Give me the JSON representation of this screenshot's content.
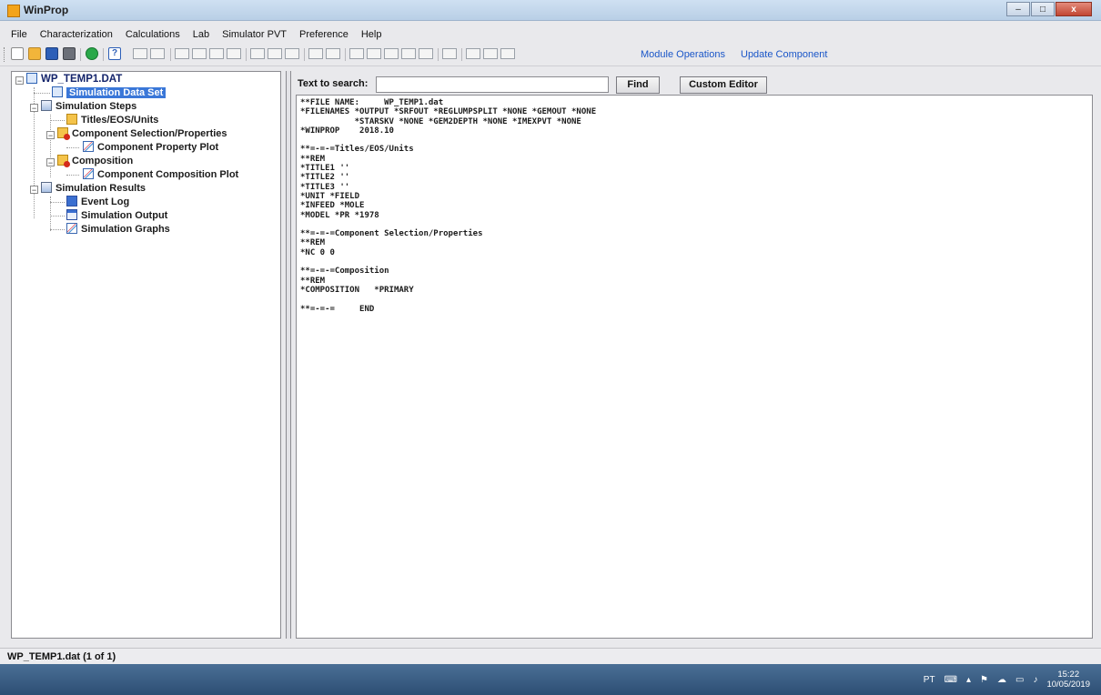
{
  "window": {
    "title": "WinProp"
  },
  "window_controls": {
    "minimize": "–",
    "maximize": "□",
    "close": "x"
  },
  "menu": [
    "File",
    "Characterization",
    "Calculations",
    "Lab",
    "Simulator PVT",
    "Preference",
    "Help"
  ],
  "toolbar": {
    "module_operations": "Module Operations",
    "update_component": "Update Component",
    "link_color": "#1a56c8"
  },
  "tree": {
    "root": "WP_TEMP1.DAT",
    "simulation_data_set": "Simulation Data Set",
    "simulation_steps": "Simulation Steps",
    "titles_eos_units": "Titles/EOS/Units",
    "component_selection": "Component Selection/Properties",
    "component_property_plot": "Component Property Plot",
    "composition": "Composition",
    "component_composition_plot": "Component Composition Plot",
    "simulation_results": "Simulation Results",
    "event_log": "Event Log",
    "simulation_output": "Simulation Output",
    "simulation_graphs": "Simulation Graphs"
  },
  "search": {
    "label": "Text to search:",
    "value": "",
    "find_button": "Find",
    "custom_editor_button": "Custom Editor"
  },
  "editor": {
    "content": "**FILE NAME:     WP_TEMP1.dat\n*FILENAMES *OUTPUT *SRFOUT *REGLUMPSPLIT *NONE *GEMOUT *NONE\n           *STARSKV *NONE *GEM2DEPTH *NONE *IMEXPVT *NONE\n*WINPROP    2018.10\n\n**=-=-=Titles/EOS/Units\n**REM\n*TITLE1 ''\n*TITLE2 ''\n*TITLE3 ''\n*UNIT *FIELD\n*INFEED *MOLE\n*MODEL *PR *1978\n\n**=-=-=Component Selection/Properties\n**REM\n*NC 0 0\n\n**=-=-=Composition\n**REM\n*COMPOSITION   *PRIMARY\n\n**=-=-=     END"
  },
  "status": {
    "text": "WP_TEMP1.dat (1 of 1)"
  },
  "taskbar": {
    "lang": "PT",
    "time": "15:22",
    "date": "10/05/2019"
  }
}
